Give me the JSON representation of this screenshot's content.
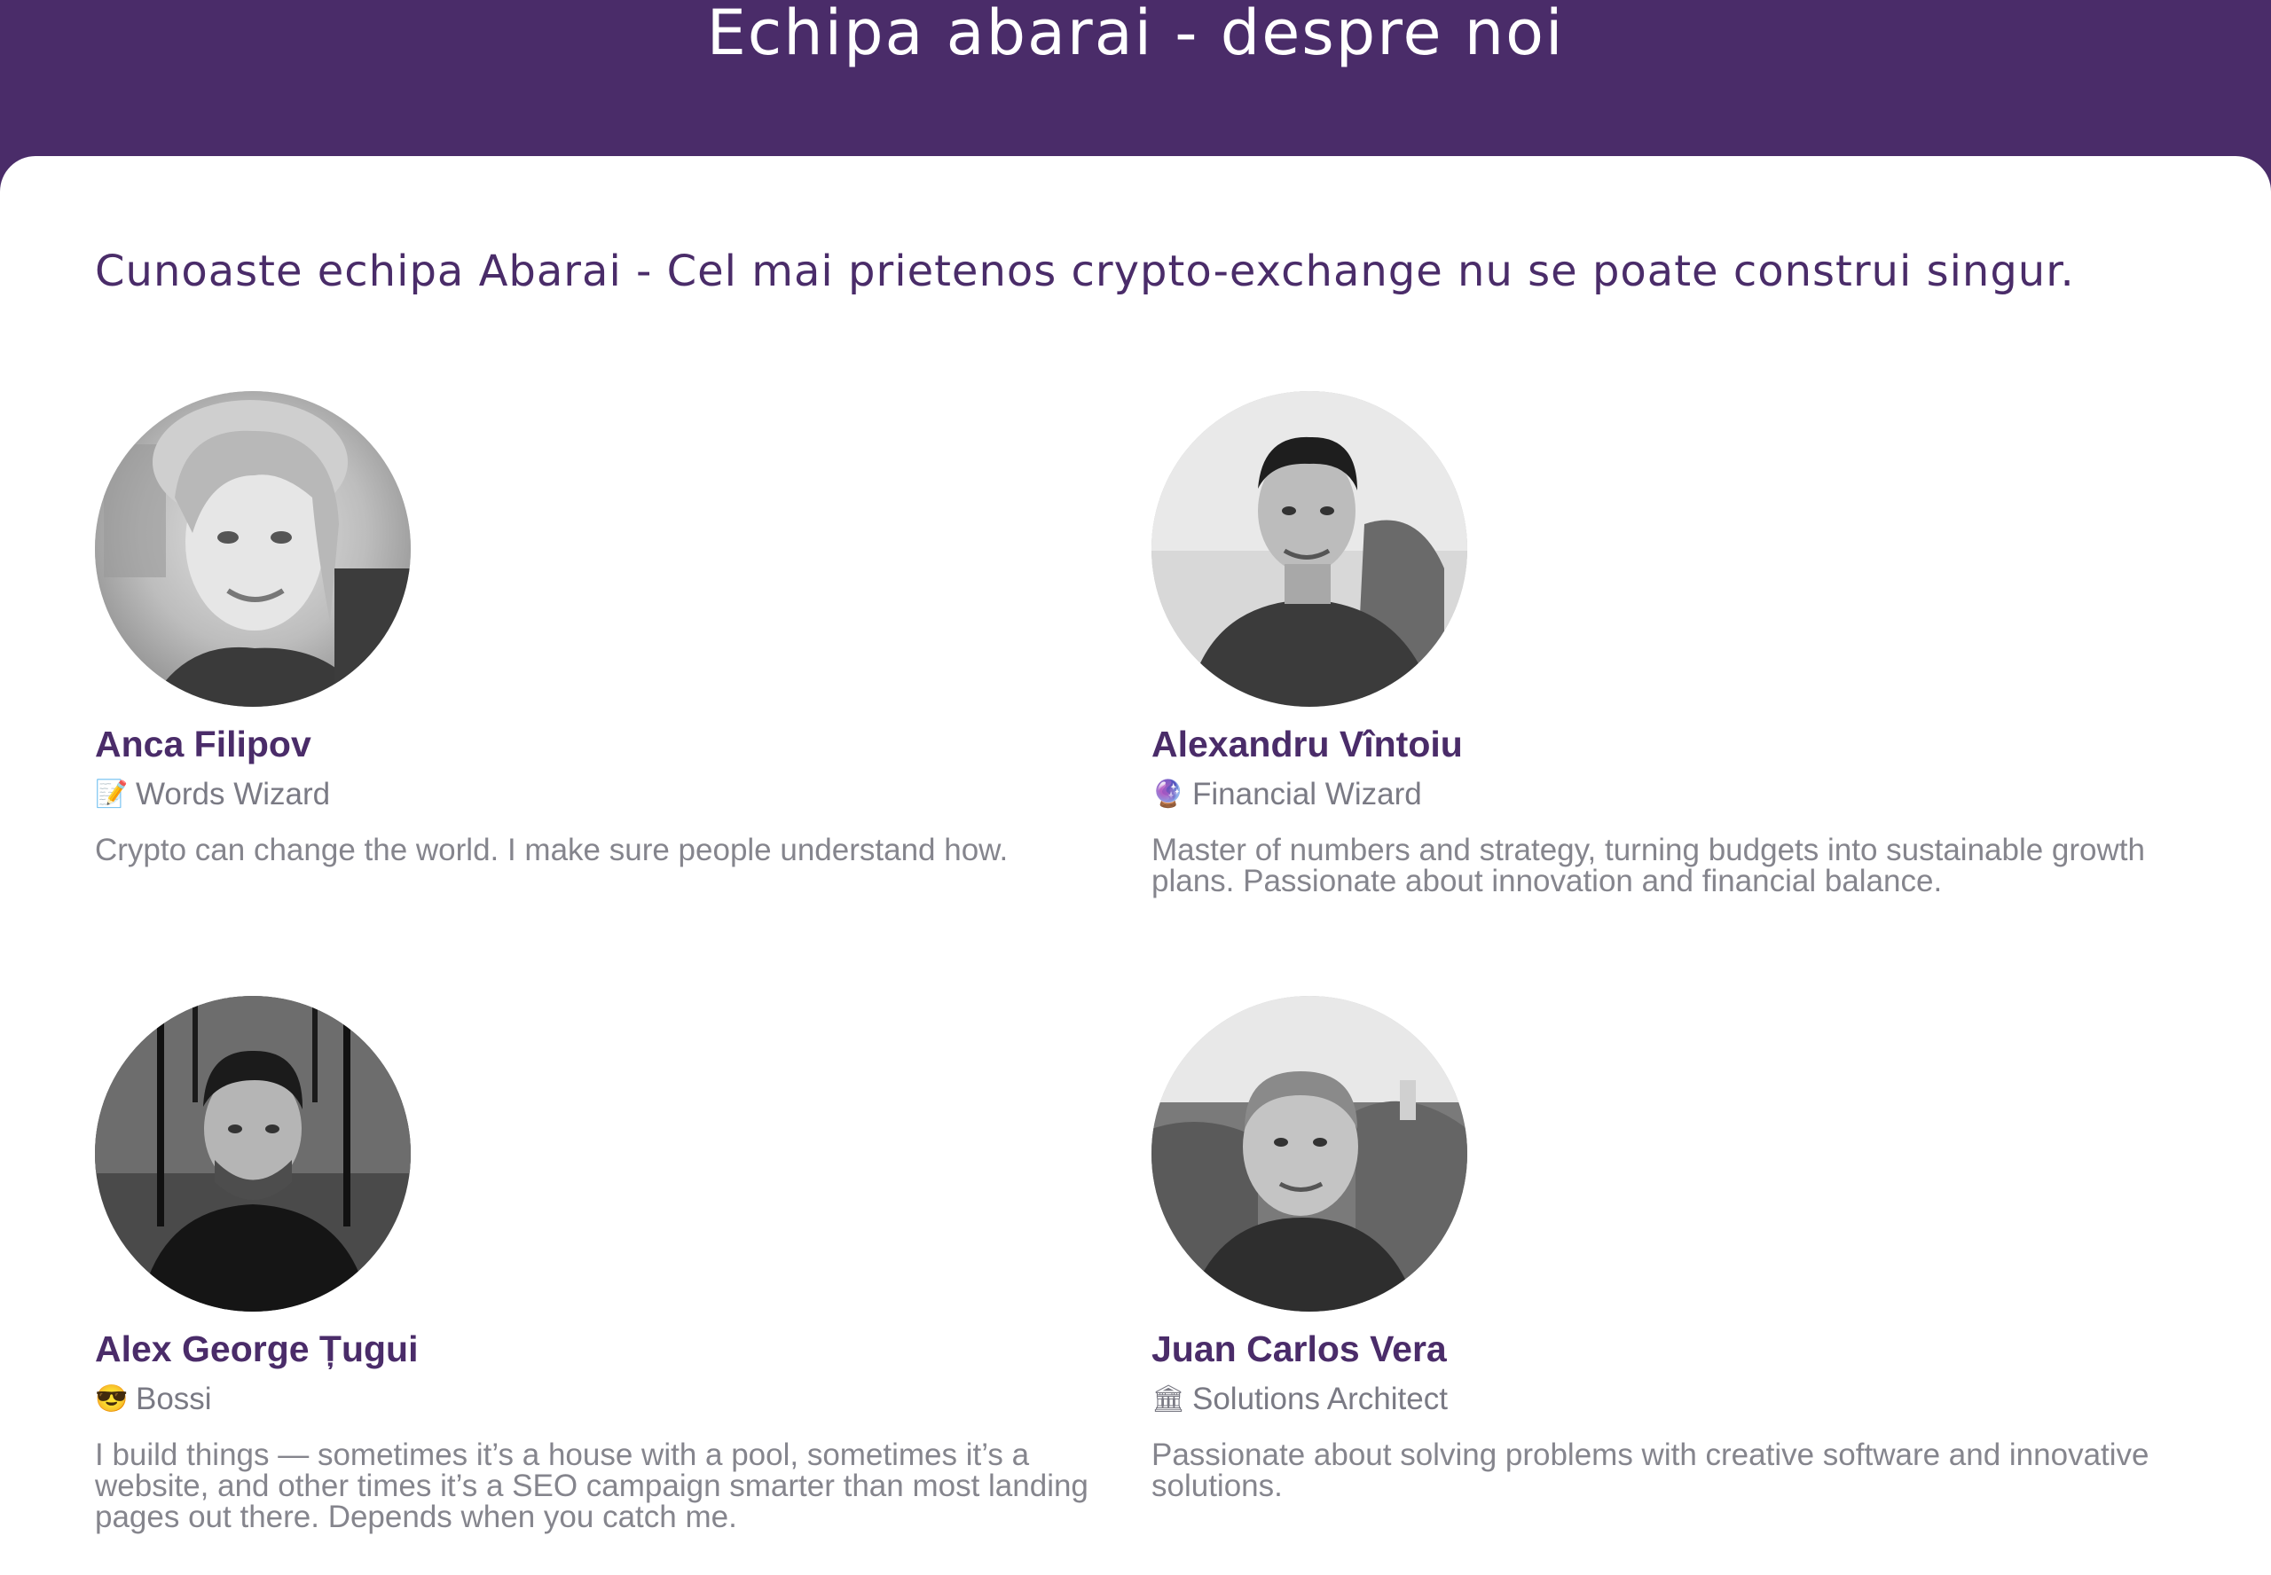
{
  "header": {
    "title": "Echipa abarai - despre noi",
    "background_color": "#4a2c69"
  },
  "intro": {
    "text": "Cunoaste echipa Abarai - Cel mai prietenos crypto-exchange nu se poate construi singur."
  },
  "team": [
    {
      "name": "Anca Filipov",
      "role": "Words Wizard",
      "role_icon": "memo-icon",
      "role_glyph": "📝",
      "bio": "Crypto can change the world. I make sure people understand how."
    },
    {
      "name": "Alexandru Vîntoiu",
      "role": "Financial Wizard",
      "role_icon": "crystal-ball-icon",
      "role_glyph": "🔮",
      "bio": "Master of numbers and strategy, turning budgets into sustainable growth plans. Passionate about innovation and financial balance."
    },
    {
      "name": "Alex George Țugui",
      "role": "Bossi",
      "role_icon": "sunglasses-face-icon",
      "role_glyph": "😎",
      "bio": "I build things — sometimes it’s a house with a pool, sometimes it’s a website, and other times it’s a SEO campaign smarter than most landing pages out there. Depends when you catch me."
    },
    {
      "name": "Juan Carlos Vera",
      "role": "Solutions Architect",
      "role_icon": "classical-building-icon",
      "role_glyph": "🏛",
      "bio": "Passionate about solving problems with creative software and innovative solutions."
    }
  ],
  "colors": {
    "accent": "#4a2c69",
    "muted_text": "#85858d"
  }
}
